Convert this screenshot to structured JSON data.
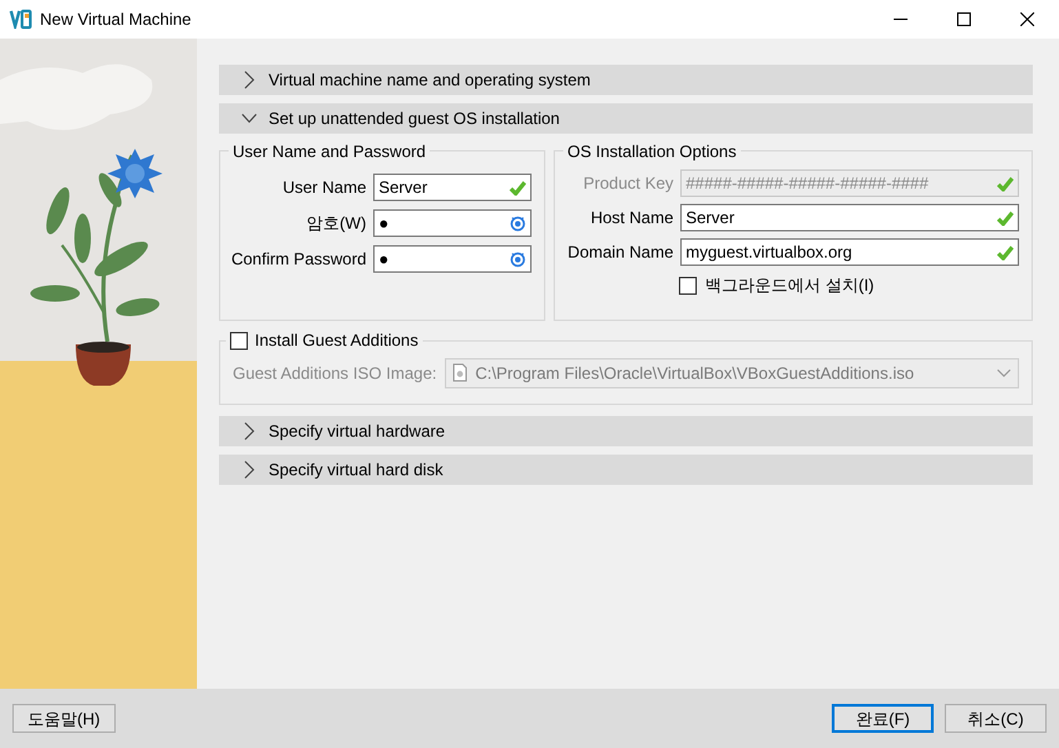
{
  "window": {
    "title": "New Virtual Machine"
  },
  "sections": [
    {
      "title": "Virtual machine name and operating system",
      "expanded": false
    },
    {
      "title": "Set up unattended guest OS installation",
      "expanded": true
    },
    {
      "title": "Specify virtual hardware",
      "expanded": false
    },
    {
      "title": "Specify virtual hard disk",
      "expanded": false
    }
  ],
  "user_group": {
    "title": "User Name and Password",
    "fields": [
      {
        "label": "User Name",
        "value": "Server",
        "kind": "text"
      },
      {
        "label": "암호(W)",
        "value": "●",
        "kind": "password"
      },
      {
        "label": "Confirm Password",
        "value": "●",
        "kind": "password"
      }
    ]
  },
  "os_group": {
    "title": "OS Installation Options",
    "fields": [
      {
        "label": "Product Key",
        "placeholder": "#####-#####-#####-#####-####",
        "kind": "text",
        "disabled": true
      },
      {
        "label": "Host Name",
        "value": "Server",
        "kind": "text",
        "disabled": false
      },
      {
        "label": "Domain Name",
        "value": "myguest.virtualbox.org",
        "kind": "text",
        "disabled": false
      }
    ],
    "background_install": {
      "label": "백그라운드에서 설치(I)",
      "checked": false
    }
  },
  "guest_additions": {
    "label": "Install Guest Additions",
    "checked": false,
    "iso_label": "Guest Additions ISO Image:",
    "iso_path": "C:\\Program Files\\Oracle\\VirtualBox\\VBoxGuestAdditions.iso"
  },
  "footer": {
    "help": "도움말(H)",
    "finish": "완료(F)",
    "cancel": "취소(C)"
  }
}
